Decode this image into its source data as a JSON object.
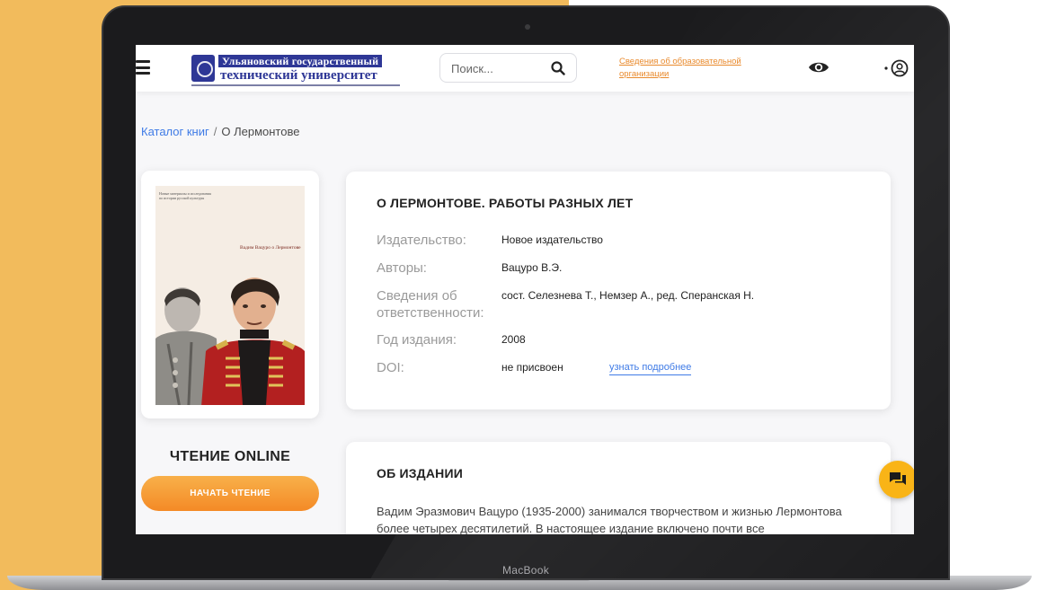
{
  "device": {
    "label": "MacBook"
  },
  "header": {
    "logo": {
      "line1": "Ульяновский государственный",
      "line2": "технический университет"
    },
    "search": {
      "placeholder": "Поиск..."
    },
    "org_link": "Сведения об образовательной организации"
  },
  "breadcrumb": {
    "catalog": "Каталог книг",
    "separator": "/",
    "current": "О Лермонтове"
  },
  "cover": {
    "small_text": "Новые материалы и исследования по истории русской культуры",
    "title_text": "Вадим Вацуро о Лермонтове"
  },
  "reading": {
    "title": "ЧТЕНИЕ ONLINE",
    "button": "НАЧАТЬ ЧТЕНИЕ"
  },
  "book": {
    "title": "О ЛЕРМОНТОВЕ. РАБОТЫ РАЗНЫХ ЛЕТ",
    "fields": [
      {
        "label": "Издательство:",
        "value": "Новое издательство"
      },
      {
        "label": "Авторы:",
        "value": "Вацуро В.Э."
      },
      {
        "label": "Сведения об ответственности:",
        "value": "сост. Селезнева Т., Немзер А., ред. Сперанская Н."
      },
      {
        "label": "Год издания:",
        "value": "2008"
      },
      {
        "label": "DOI:",
        "value": "не присвоен"
      }
    ],
    "doi_link": "узнать подробнее"
  },
  "about": {
    "title": "ОБ ИЗДАНИИ",
    "text": "Вадим Эразмович Вацуро (1935-2000) занимался творчеством и жизнью Лермонтова более четырех десятилетий. В настоящее издание включено почти все"
  },
  "colors": {
    "accent_orange": "#f48a26",
    "link_blue": "#3f7be6",
    "chat_yellow": "#f9b417",
    "background_yellow": "#f2bb5c"
  }
}
